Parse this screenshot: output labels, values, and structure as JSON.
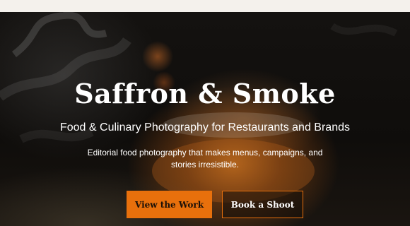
{
  "hero": {
    "title": "Saffron & Smoke",
    "subtitle": "Food & Culinary Photography for Restaurants and Brands",
    "description": "Editorial food photography that makes menus, campaigns, and stories irresistible.",
    "primary_button": "View the Work",
    "secondary_button": "Book a Shoot"
  },
  "colors": {
    "accent": "#e8700c",
    "topbar": "#f4f1ec",
    "hero_text": "#ffffff"
  }
}
